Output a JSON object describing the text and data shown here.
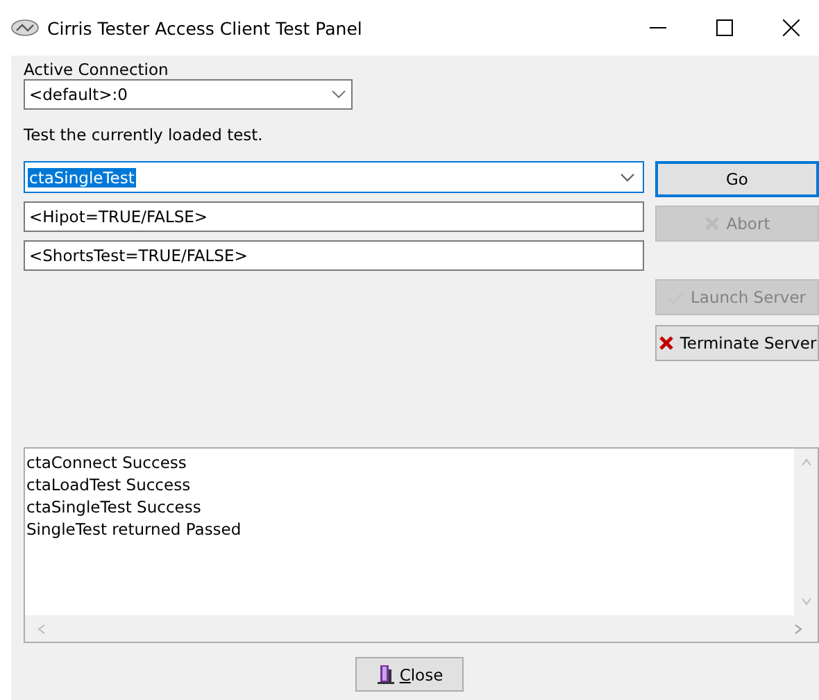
{
  "window": {
    "title": "Cirris Tester Access Client Test Panel"
  },
  "connection": {
    "label": "Active Connection",
    "value": "<default>:0"
  },
  "description": "Test the currently loaded test.",
  "test_select": {
    "value": "ctaSingleTest",
    "selected_text": true
  },
  "parameters": [
    {
      "value": "<Hipot=TRUE/FALSE>"
    },
    {
      "value": "<ShortsTest=TRUE/FALSE>"
    }
  ],
  "buttons": [
    {
      "label": "Go",
      "kind": "plain",
      "disabled": false,
      "focused": true
    },
    {
      "label": "Abort",
      "kind": "abort",
      "disabled": true,
      "focused": false
    },
    {
      "label": "Launch Server",
      "kind": "launch",
      "disabled": true,
      "focused": false
    },
    {
      "label": "Terminate Server",
      "kind": "terminate",
      "disabled": false,
      "focused": false
    }
  ],
  "log": [
    "ctaConnect Success",
    "ctaLoadTest Success",
    "ctaSingleTest Success",
    "SingleTest returned Passed"
  ],
  "close_button": {
    "label": "Close"
  }
}
